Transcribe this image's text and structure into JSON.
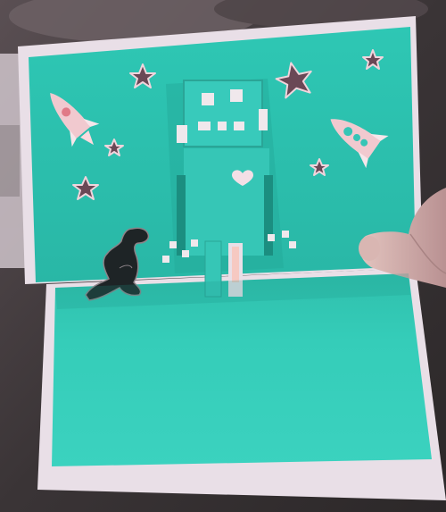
{
  "photo": {
    "subject": "pop-up-greeting-card",
    "colors": {
      "table": "#3a3436",
      "card_border": "#e8dde6",
      "card_teal_back": "#2ec7b4",
      "card_teal_base": "#32cdb9",
      "robot_teal": "#37c9b9",
      "robot_shadow": "#1f9c8e",
      "dino": "#1e2426",
      "star_fill": "#6a4856",
      "rocket_pink": "#f1c9cf",
      "skin": "#c9a6a6"
    },
    "elements": {
      "robot": "robot-popup",
      "dinosaur": "dinosaur-cutout",
      "rockets": [
        "rocket-left",
        "rocket-right"
      ],
      "stars": [
        "star",
        "star",
        "star",
        "star",
        "star",
        "star"
      ],
      "heart": "heart-cutout"
    }
  }
}
